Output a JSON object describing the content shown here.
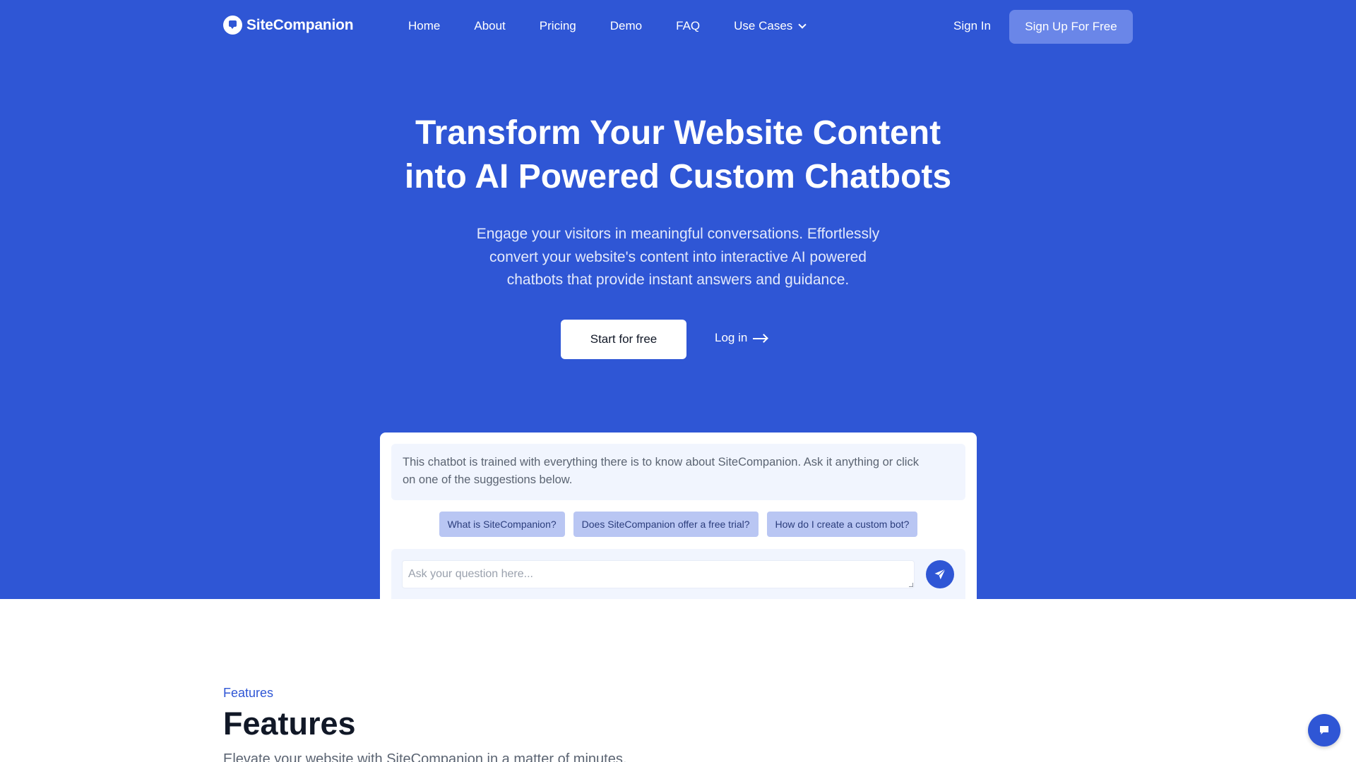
{
  "brand": {
    "name": "SiteCompanion",
    "logo_icon": "chat-bubble-icon",
    "accent": "#2f56d5"
  },
  "nav": {
    "links": [
      {
        "label": "Home"
      },
      {
        "label": "About"
      },
      {
        "label": "Pricing"
      },
      {
        "label": "Demo"
      },
      {
        "label": "FAQ"
      },
      {
        "label": "Use Cases",
        "icon": "chevron-down-icon"
      }
    ],
    "sign_in": "Sign In",
    "sign_up": "Sign Up For Free"
  },
  "hero": {
    "title_line1": "Transform Your Website Content",
    "title_line2": "into AI Powered Custom Chatbots",
    "subtitle_line1": "Engage your visitors in meaningful conversations. Effortlessly",
    "subtitle_line2": "convert your website's content into interactive AI powered",
    "subtitle_line3": "chatbots that provide instant answers and guidance.",
    "cta_primary": "Start for free",
    "cta_secondary": "Log in"
  },
  "chat": {
    "intro_line1": "This chatbot is trained with everything there is to know about SiteCompanion. Ask it anything or click",
    "intro_line2": "on one of the suggestions below.",
    "suggestions": [
      "What is SiteCompanion?",
      "Does SiteCompanion offer a free trial?",
      "How do I create a custom bot?"
    ],
    "input_placeholder": "Ask your question here...",
    "send_icon": "paper-plane-icon"
  },
  "features": {
    "eyebrow": "Features",
    "title": "Features",
    "subtitle": "Elevate your website with SiteCompanion in a matter of minutes."
  },
  "floating_chat": {
    "icon": "chat-bubble-icon"
  }
}
